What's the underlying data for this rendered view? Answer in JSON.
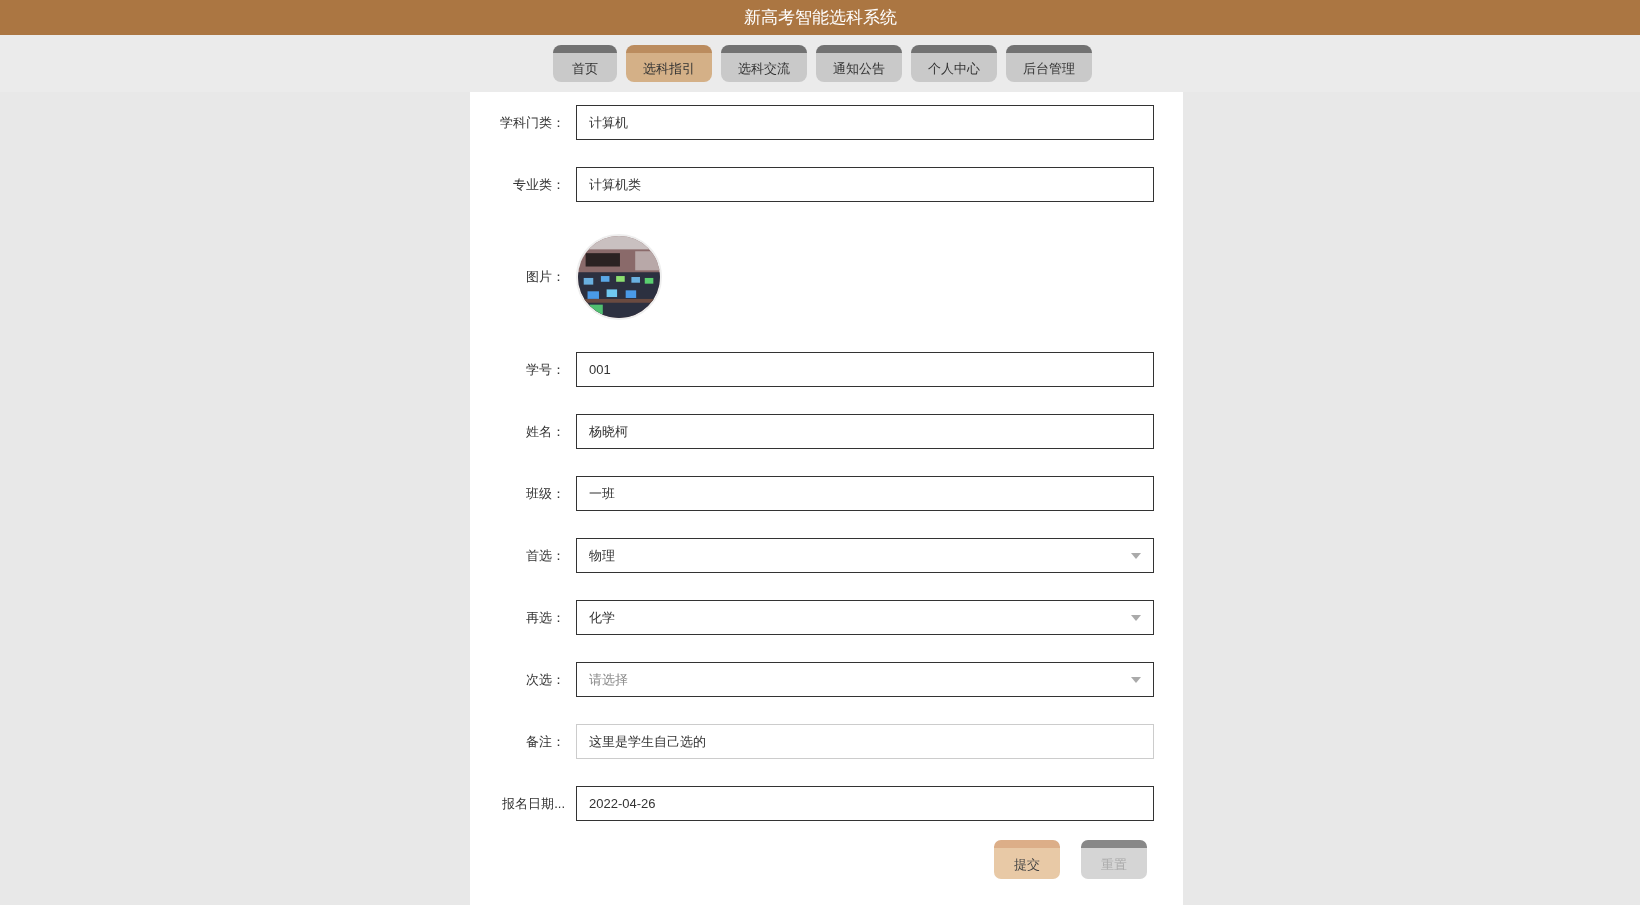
{
  "header": {
    "title": "新高考智能选科系统"
  },
  "nav": [
    {
      "label": "首页",
      "selected": false
    },
    {
      "label": "选科指引",
      "selected": true
    },
    {
      "label": "选科交流",
      "selected": false
    },
    {
      "label": "通知公告",
      "selected": false
    },
    {
      "label": "个人中心",
      "selected": false
    },
    {
      "label": "后台管理",
      "selected": false
    }
  ],
  "form": {
    "fields": [
      {
        "kind": "input",
        "label": "学科门类：",
        "value": "计算机"
      },
      {
        "kind": "input",
        "label": "专业类：",
        "value": "计算机类"
      },
      {
        "label": "图片："
      },
      {
        "kind": "input",
        "label": "学号：",
        "value": "001"
      },
      {
        "kind": "input",
        "label": "姓名：",
        "value": "杨晓柯"
      },
      {
        "kind": "input",
        "label": "班级：",
        "value": "一班"
      },
      {
        "kind": "select",
        "label": "首选：",
        "value": "物理"
      },
      {
        "kind": "select",
        "label": "再选：",
        "value": "化学"
      },
      {
        "kind": "select",
        "label": "次选：",
        "placeholder": "请选择"
      },
      {
        "kind": "textarea",
        "label": "备注：",
        "value": "这里是学生自己选的"
      },
      {
        "kind": "input",
        "label": "报名日期...",
        "value": "2022-04-26"
      }
    ],
    "buttons": [
      {
        "kind": "primary",
        "label": "提交"
      },
      {
        "kind": "secondary",
        "label": "重置"
      }
    ]
  }
}
